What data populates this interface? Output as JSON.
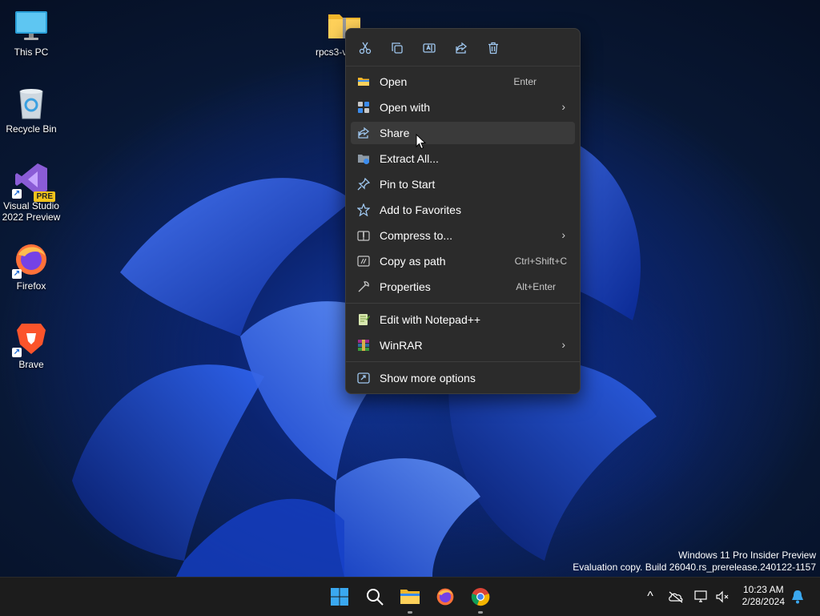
{
  "desktop": {
    "icons": [
      {
        "label": "This PC"
      },
      {
        "label": "Recycle Bin"
      },
      {
        "label": "Visual Studio\n2022 Preview",
        "badge": "PRE"
      },
      {
        "label": "Firefox"
      },
      {
        "label": "Brave"
      },
      {
        "label": "rpcs3-v"
      }
    ]
  },
  "context_menu": {
    "toolbar": [
      {
        "name": "cut-icon",
        "tooltip": "Cut"
      },
      {
        "name": "copy-icon",
        "tooltip": "Copy"
      },
      {
        "name": "rename-icon",
        "tooltip": "Rename"
      },
      {
        "name": "share-icon",
        "tooltip": "Share"
      },
      {
        "name": "delete-icon",
        "tooltip": "Delete"
      }
    ],
    "items": [
      {
        "label": "Open",
        "shortcut": "Enter",
        "icon": "folder-icon"
      },
      {
        "label": "Open with",
        "icon": "open-with-icon",
        "submenu": true
      },
      {
        "label": "Share",
        "icon": "share-icon",
        "hover": true
      },
      {
        "label": "Extract All...",
        "icon": "extract-icon"
      },
      {
        "label": "Pin to Start",
        "icon": "pin-icon"
      },
      {
        "label": "Add to Favorites",
        "icon": "star-icon"
      },
      {
        "label": "Compress to...",
        "icon": "compress-icon",
        "submenu": true
      },
      {
        "label": "Copy as path",
        "shortcut": "Ctrl+Shift+C",
        "icon": "copy-path-icon"
      },
      {
        "label": "Properties",
        "shortcut": "Alt+Enter",
        "icon": "wrench-icon"
      },
      {
        "label": "Edit with Notepad++",
        "icon": "notepad-plus-plus-icon"
      },
      {
        "label": "WinRAR",
        "icon": "winrar-icon",
        "submenu": true
      },
      {
        "label": "Show more options",
        "icon": "more-options-icon"
      }
    ],
    "submenu_arrow": "›"
  },
  "watermark": {
    "line1": "Windows 11 Pro Insider Preview",
    "line2": "Evaluation copy. Build 26040.rs_prerelease.240122-1157"
  },
  "taskbar": {
    "time": "10:23 AM",
    "date": "2/28/2024",
    "chevron": "^"
  },
  "colors": {
    "menu_bg": "#2b2b2b",
    "hover_bg": "#3a3a3a",
    "taskbar_bg": "#1c1c1c",
    "accent": "#3b8ced"
  }
}
